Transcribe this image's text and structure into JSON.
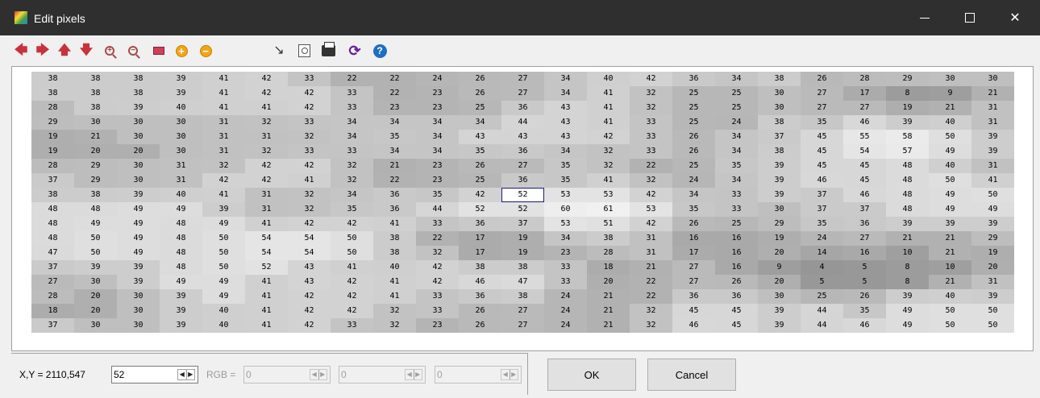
{
  "window": {
    "title": "Edit pixels",
    "minimize": "—",
    "close": "✕"
  },
  "toolbar": {
    "buttons": [
      {
        "icon": "arrow-left-icon",
        "glyph": "🡄"
      },
      {
        "icon": "arrow-right-icon",
        "glyph": "🡆"
      },
      {
        "icon": "arrow-up-icon",
        "glyph": "🡅"
      },
      {
        "icon": "arrow-down-icon",
        "glyph": "🡇"
      },
      {
        "icon": "zoom-in-icon",
        "glyph": "+"
      },
      {
        "icon": "zoom-out-icon",
        "glyph": "−"
      },
      {
        "icon": "rectangle-icon",
        "glyph": ""
      },
      {
        "icon": "add-circle-icon",
        "glyph": "+"
      },
      {
        "icon": "remove-circle-icon",
        "glyph": "−"
      },
      {
        "icon": "color-picker-icon",
        "glyph": "↘"
      },
      {
        "icon": "preview-icon",
        "glyph": ""
      },
      {
        "icon": "print-icon",
        "glyph": ""
      },
      {
        "icon": "refresh-icon",
        "glyph": "⟳"
      },
      {
        "icon": "help-icon",
        "glyph": "?"
      }
    ]
  },
  "grid": {
    "selected": {
      "row": 8,
      "col": 11
    },
    "rows": [
      [
        38,
        38,
        38,
        39,
        41,
        42,
        33,
        22,
        22,
        24,
        26,
        27,
        34,
        40,
        42,
        36,
        34,
        38,
        26,
        28,
        29,
        30,
        30
      ],
      [
        38,
        38,
        38,
        39,
        41,
        42,
        42,
        33,
        22,
        23,
        26,
        27,
        34,
        41,
        32,
        25,
        25,
        30,
        27,
        17,
        8,
        9,
        21
      ],
      [
        28,
        38,
        39,
        40,
        41,
        41,
        42,
        33,
        23,
        23,
        25,
        36,
        43,
        41,
        32,
        25,
        25,
        30,
        27,
        27,
        19,
        21,
        31
      ],
      [
        29,
        30,
        30,
        30,
        31,
        32,
        33,
        34,
        34,
        34,
        34,
        44,
        43,
        41,
        33,
        25,
        24,
        38,
        35,
        46,
        39,
        40,
        31
      ],
      [
        19,
        21,
        30,
        30,
        31,
        31,
        32,
        34,
        35,
        34,
        43,
        43,
        43,
        42,
        33,
        26,
        34,
        37,
        45,
        55,
        58,
        50,
        39
      ],
      [
        19,
        20,
        20,
        30,
        31,
        32,
        33,
        33,
        34,
        34,
        35,
        36,
        34,
        32,
        33,
        26,
        34,
        38,
        45,
        54,
        57,
        49,
        39
      ],
      [
        28,
        29,
        30,
        31,
        32,
        42,
        42,
        32,
        21,
        23,
        26,
        27,
        35,
        32,
        22,
        25,
        35,
        39,
        45,
        45,
        48,
        40,
        31
      ],
      [
        37,
        29,
        30,
        31,
        42,
        42,
        41,
        32,
        22,
        23,
        25,
        36,
        35,
        41,
        32,
        24,
        34,
        39,
        46,
        45,
        48,
        50,
        41
      ],
      [
        38,
        38,
        39,
        40,
        41,
        31,
        32,
        34,
        36,
        35,
        42,
        52,
        53,
        53,
        42,
        34,
        33,
        39,
        37,
        46,
        48,
        49,
        50
      ],
      [
        48,
        48,
        49,
        49,
        39,
        31,
        32,
        35,
        36,
        44,
        52,
        52,
        60,
        61,
        53,
        35,
        33,
        30,
        37,
        37,
        48,
        49,
        49
      ],
      [
        48,
        49,
        49,
        48,
        49,
        41,
        42,
        42,
        41,
        33,
        36,
        37,
        53,
        51,
        42,
        26,
        25,
        29,
        35,
        36,
        39,
        39,
        39
      ],
      [
        48,
        50,
        49,
        48,
        50,
        54,
        54,
        50,
        38,
        22,
        17,
        19,
        34,
        38,
        31,
        16,
        16,
        19,
        24,
        27,
        21,
        21,
        29
      ],
      [
        47,
        50,
        49,
        48,
        50,
        54,
        54,
        50,
        38,
        32,
        17,
        19,
        23,
        28,
        31,
        17,
        16,
        20,
        14,
        16,
        10,
        21,
        19
      ],
      [
        37,
        39,
        39,
        48,
        50,
        52,
        43,
        41,
        40,
        42,
        38,
        38,
        33,
        18,
        21,
        27,
        16,
        9,
        4,
        5,
        8,
        10,
        20
      ],
      [
        27,
        30,
        39,
        49,
        49,
        41,
        43,
        42,
        41,
        42,
        46,
        47,
        33,
        20,
        22,
        27,
        26,
        20,
        5,
        5,
        8,
        21,
        31
      ],
      [
        28,
        20,
        30,
        39,
        49,
        41,
        42,
        42,
        41,
        33,
        36,
        38,
        24,
        21,
        22,
        36,
        36,
        30,
        25,
        26,
        39,
        40,
        39
      ],
      [
        18,
        20,
        30,
        39,
        40,
        41,
        42,
        42,
        32,
        33,
        26,
        27,
        24,
        21,
        32,
        45,
        45,
        39,
        44,
        35,
        49,
        50,
        50
      ],
      [
        37,
        30,
        30,
        39,
        40,
        41,
        42,
        33,
        32,
        23,
        26,
        27,
        24,
        21,
        32,
        46,
        45,
        39,
        44,
        46,
        49,
        50,
        50
      ]
    ]
  },
  "footer": {
    "coord_label": "X,Y = 2110,547",
    "value_input": "52",
    "rgb_label": "RGB =",
    "rgb_r": "0",
    "rgb_g": "0",
    "rgb_b": "0",
    "spin_left": "◀",
    "spin_right": "▶",
    "ok_label": "OK",
    "cancel_label": "Cancel"
  }
}
